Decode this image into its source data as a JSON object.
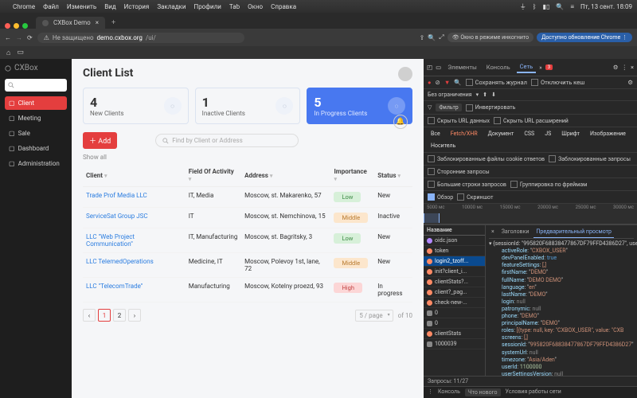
{
  "menubar": {
    "items": [
      "Chrome",
      "Файл",
      "Изменить",
      "Вид",
      "История",
      "Закладки",
      "Профили",
      "Tab",
      "Окно",
      "Справка"
    ],
    "time": "Пт, 13 сент. 18:09"
  },
  "browser": {
    "tab_title": "CXBox Demo",
    "url_insecure": "Не защищено",
    "url_host": "demo.cxbox.org",
    "url_path": "/ui/",
    "incognito": "Окно в режиме инкогнито",
    "update": "Доступно обновление Chrome"
  },
  "app": {
    "brand": "CXBox",
    "nav": [
      {
        "icon": "user",
        "label": "Client",
        "active": true
      },
      {
        "icon": "clock",
        "label": "Meeting"
      },
      {
        "icon": "tag",
        "label": "Sale"
      },
      {
        "icon": "grid",
        "label": "Dashboard"
      },
      {
        "icon": "shield",
        "label": "Administration"
      }
    ],
    "title": "Client List",
    "cards": [
      {
        "n": "4",
        "label": "New Clients",
        "variant": "plain",
        "icon": "user"
      },
      {
        "n": "1",
        "label": "Inactive Clients",
        "variant": "plain",
        "icon": "calendar"
      },
      {
        "n": "5",
        "label": "In Progress Clients",
        "variant": "blue",
        "icon": "doc"
      }
    ],
    "add_label": "Add",
    "find_placeholder": "Find by Client or Address",
    "showall": "Show all",
    "columns": [
      "Client",
      "Field Of Activity",
      "Address",
      "Importance",
      "Status"
    ],
    "rows": [
      {
        "client": "Trade Prof Media LLC",
        "field": "IT, Media",
        "addr": "Moscow, st. Makarenko, 57",
        "imp": "Low",
        "imp_c": "b-low",
        "status": "New"
      },
      {
        "client": "ServiceSat Group JSC",
        "field": "IT",
        "addr": "Moscow, st. Nemchinova, 15",
        "imp": "Middle",
        "imp_c": "b-mid",
        "status": "Inactive"
      },
      {
        "client": "LLC \"Web Project Communication\"",
        "field": "IT, Manufacturing",
        "addr": "Moscow, st. Bagritsky, 3",
        "imp": "Low",
        "imp_c": "b-low",
        "status": "New"
      },
      {
        "client": "LLC TelemedOperations",
        "field": "Medicine, IT",
        "addr": "Moscow, Polevoy 1st, lane, 72",
        "imp": "Middle",
        "imp_c": "b-mid",
        "status": "New"
      },
      {
        "client": "LLC \"TelecomTrade\"",
        "field": "Manufacturing",
        "addr": "Moscow, Kotelny proezd, 93",
        "imp": "High",
        "imp_c": "b-high",
        "status": "In progress"
      }
    ],
    "pager": {
      "page": "1",
      "next": "2",
      "size": "5 / page",
      "total": "of 10"
    }
  },
  "devtools": {
    "tabs": [
      "Элементы",
      "Консоль",
      "Сеть"
    ],
    "active_tab": 2,
    "badge": "3",
    "preserve": "Сохранять журнал",
    "disable_cache": "Отключить кеш",
    "throttle": "Без ограничения",
    "filter_label": "Фильтр",
    "invert": "Инвертировать",
    "hide_data": "Скрыть URL данных",
    "hide_ext": "Скрыть URL расширений",
    "types": [
      "Все",
      "Fetch/XHR",
      "Документ",
      "CSS",
      "JS",
      "Шрифт",
      "Изображение",
      "Носитель"
    ],
    "blocked_cookies": "Заблокированные файлы cookie ответов",
    "blocked_req": "Заблокированные запросы",
    "third_party": "Сторонние запросы",
    "big_rows": "Большие строки запросов",
    "group_frame": "Группировка по фреймам",
    "overview": "Обзор",
    "screenshot": "Скриншот",
    "ticks": [
      "5000 мс",
      "10000 мс",
      "15000 мс",
      "20000 мс",
      "25000 мс",
      "30000 мс"
    ],
    "col_name": "Название",
    "detail_tabs": [
      "×",
      "Заголовки",
      "Предварительный просмотр"
    ],
    "reqs": [
      {
        "name": "oidc.json",
        "t": "json"
      },
      {
        "name": "token",
        "t": "xhr"
      },
      {
        "name": "init?client_i...",
        "t": "xhr"
      },
      {
        "name": "clientStats?...",
        "t": "xhr"
      },
      {
        "name": "client?_pag...",
        "t": "xhr"
      },
      {
        "name": "check-new-...",
        "t": "xhr"
      },
      {
        "name": "0",
        "t": "num"
      },
      {
        "name": "0",
        "t": "num"
      },
      {
        "name": "clientStats",
        "t": "xhr"
      },
      {
        "name": "1000039",
        "t": "num"
      }
    ],
    "sel_req": "login2_tzoff...",
    "json": {
      "activeRole": "CXBOX_USER",
      "devPanelEnabled": "true",
      "featureSettings_note": "[,]",
      "firstName": "DEMO",
      "fullName": "DEMO DEMO",
      "language": "en",
      "lastName": "DEMO",
      "login": "null",
      "patronymic": "null",
      "phone": "DEMO",
      "principalName": "DEMO",
      "roles_note": "[{type: null, key: \"CXBOX_USER\", value: \"CXB",
      "screens_note": "[,]",
      "sessionId": "995820F68838477867DF79FFD4386D27",
      "systemUrl": "null",
      "timezone": "Asia/Aden",
      "userId": "1100000",
      "userSettingsVersion": "null"
    },
    "top_session": "{sessionId: \"995820F68838477867DF79FFD4386D27\", userI",
    "status_left": "Запросы: 11/27",
    "status_mid": "Что нового",
    "status_right": "Условия работы сети"
  }
}
